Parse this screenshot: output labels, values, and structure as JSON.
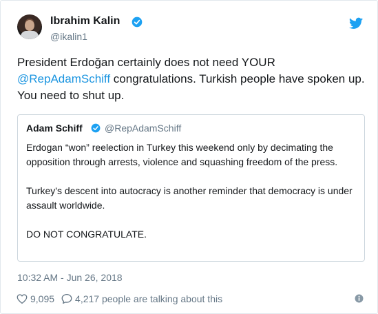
{
  "tweet": {
    "author_name": "Ibrahim Kalin",
    "author_handle": "@ikalin1",
    "text_before": "President Erdoğan certainly does not need YOUR ",
    "mention": "@RepAdamSchiff",
    "text_after": " congratulations. Turkish people have spoken up. You need to shut up.",
    "timestamp": "10:32 AM - Jun 26, 2018",
    "likes": "9,095",
    "talking": "4,217 people are talking about this"
  },
  "quoted": {
    "author_name": "Adam Schiff",
    "author_handle": "@RepAdamSchiff",
    "paragraphs": [
      "Erdogan “won” reelection in Turkey this weekend only by decimating the opposition through arrests, violence and squashing freedom of the press.",
      "Turkey's descent into autocracy is another reminder that democracy is under assault worldwide.",
      "DO NOT CONGRATULATE."
    ]
  },
  "colors": {
    "link": "#1b95e0",
    "secondary_text": "#657786",
    "verified": "#1da1f2",
    "border": "#ccd6dd"
  },
  "icons": {
    "verified": "verified-badge-icon",
    "bird": "twitter-bird-icon",
    "like": "heart-icon",
    "reply": "speech-bubble-icon",
    "info": "info-icon"
  }
}
